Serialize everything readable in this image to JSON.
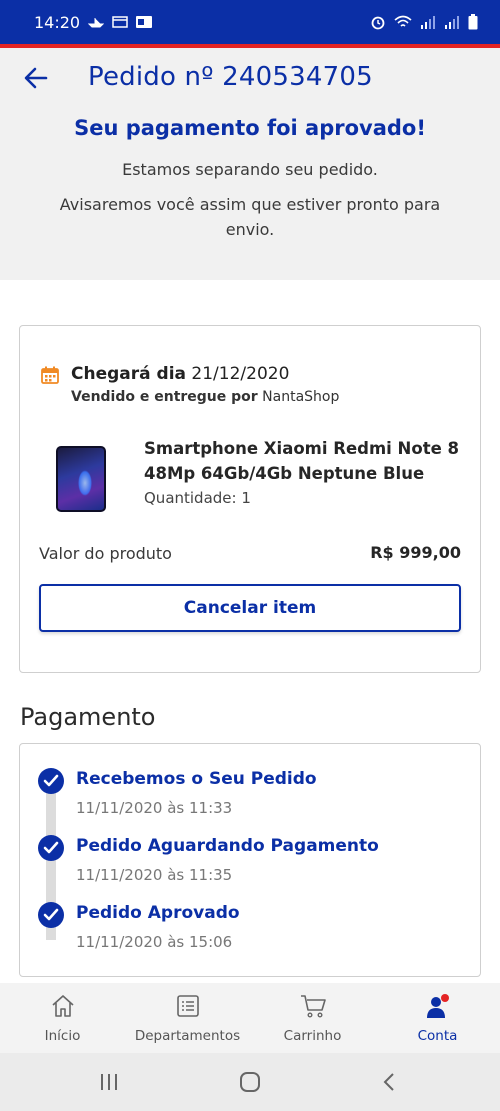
{
  "status_bar": {
    "time": "14:20",
    "left_icons": [
      "boat-notification-icon",
      "calendar-notification-icon",
      "outlook-notification-icon"
    ],
    "right_icons": [
      "alarm-icon",
      "wifi-icon",
      "signal-icon",
      "signal-icon",
      "battery-icon"
    ]
  },
  "header": {
    "back_icon": "arrow-left-icon",
    "order_title": "Pedido nº 240534705",
    "approved_message": "Seu pagamento foi aprovado!",
    "subtitle_1": "Estamos separando seu pedido.",
    "subtitle_2": "Avisaremos você assim que estiver pronto para envio."
  },
  "delivery_card": {
    "arrival_label": "Chegará dia",
    "arrival_date": "21/12/2020",
    "seller_label": "Vendido e entregue por",
    "seller_name": "NantaShop",
    "product_name": "Smartphone Xiaomi Redmi Note 8 48Mp 64Gb/4Gb Neptune Blue",
    "quantity_label": "Quantidade: 1",
    "value_label": "Valor do produto",
    "value_amount": "R$ 999,00",
    "cancel_button": "Cancelar item"
  },
  "payment": {
    "section_title": "Pagamento",
    "steps": [
      {
        "title": "Recebemos o Seu Pedido",
        "date": "11/11/2020 às 11:33"
      },
      {
        "title": "Pedido Aguardando Pagamento",
        "date": "11/11/2020 às 11:35"
      },
      {
        "title": "Pedido Aprovado",
        "date": "11/11/2020 às 15:06"
      }
    ]
  },
  "bottom_nav": {
    "items": [
      {
        "label": "Início",
        "icon": "home-icon"
      },
      {
        "label": "Departamentos",
        "icon": "list-icon"
      },
      {
        "label": "Carrinho",
        "icon": "cart-icon"
      },
      {
        "label": "Conta",
        "icon": "account-icon"
      }
    ],
    "active": "Conta"
  },
  "colors": {
    "brand_blue": "#0b2fa6",
    "accent_red": "#e42424",
    "calendar_orange": "#f08a24"
  }
}
